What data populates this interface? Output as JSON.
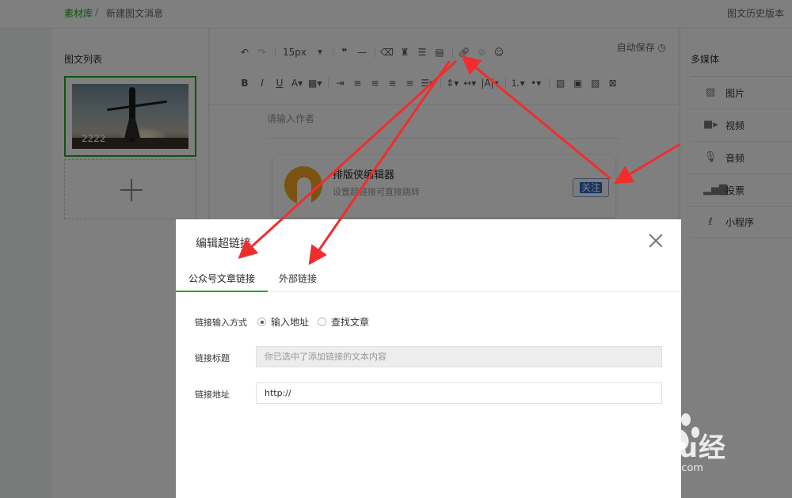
{
  "topbar": {
    "breadcrumb_home": "素材库",
    "breadcrumb_sep": "/",
    "breadcrumb_current": "新建图文消息",
    "history": "图文历史版本"
  },
  "left_panel": {
    "title": "图文列表",
    "articles": [
      {
        "label": "2222"
      }
    ]
  },
  "toolbar": {
    "font_size": "15px",
    "autosave": "自动保存"
  },
  "editor": {
    "author_placeholder": "请输入作者",
    "card": {
      "title": "排版侠编辑器",
      "subtitle": "设置超链接可直接跳转",
      "follow_label": "关注"
    }
  },
  "right_panel": {
    "title": "多媒体",
    "items": [
      {
        "label": "图片",
        "icon": "image-icon"
      },
      {
        "label": "视频",
        "icon": "video-icon"
      },
      {
        "label": "音频",
        "icon": "audio-icon"
      },
      {
        "label": "投票",
        "icon": "vote-icon"
      },
      {
        "label": "小程序",
        "icon": "miniprogram-icon"
      }
    ]
  },
  "dialog": {
    "title": "编辑超链接",
    "tabs": [
      {
        "label": "公众号文章链接"
      },
      {
        "label": "外部链接"
      }
    ],
    "input_method_label": "链接输入方式",
    "radio_options": [
      {
        "label": "输入地址",
        "checked": true
      },
      {
        "label": "查找文章",
        "checked": false
      }
    ],
    "link_title_label": "链接标题",
    "link_title_placeholder": "你已选中了添加链接的文本内容",
    "link_url_label": "链接地址",
    "link_url_value": "http://"
  },
  "watermark": {
    "text": "Baidu经验",
    "url": "jingyan.baidu.com"
  },
  "colors": {
    "accent": "#1aad19",
    "arrow": "#f02d2d",
    "follow_highlight": "#2f66c2"
  }
}
